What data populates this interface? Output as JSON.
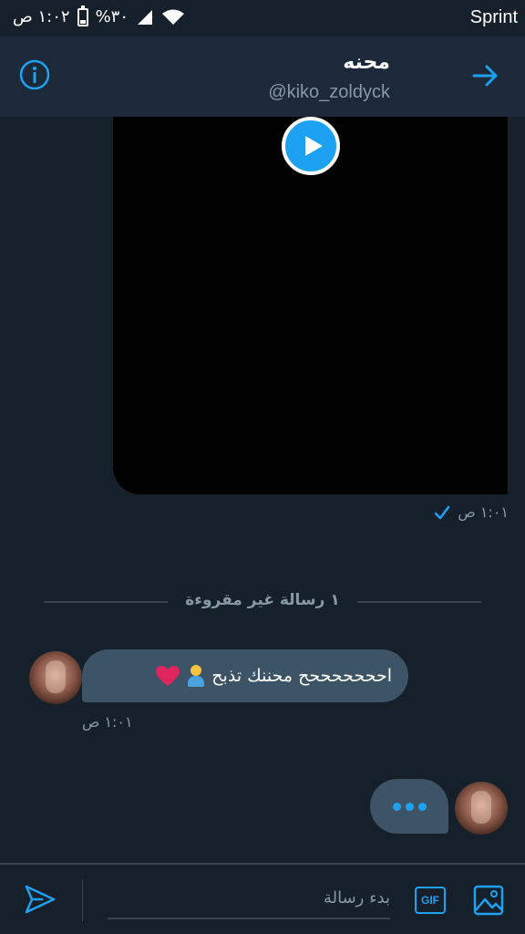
{
  "status_bar": {
    "time": "١:٠٢ ص",
    "battery": "%٣٠",
    "carrier": "Sprint"
  },
  "header": {
    "title": "محنه",
    "handle": "@kiko_zoldyck",
    "info_icon": "info-icon",
    "back_icon": "arrow-icon"
  },
  "messages": {
    "sent_video": {
      "time": "١:٠١ ص",
      "status_icon": "check-icon"
    },
    "unread_divider": "١ رسالة غير مقروءة",
    "received": {
      "text": "احححححححح محننك تذبح",
      "time": "١:٠١ ص"
    }
  },
  "composer": {
    "placeholder": "بدء رسالة",
    "gif_label": "GIF"
  },
  "colors": {
    "accent": "#1da1f2",
    "background": "#15202b",
    "header": "#1c2938",
    "bubble": "#3d5466",
    "muted": "#8899a6",
    "heart": "#e0245e"
  }
}
